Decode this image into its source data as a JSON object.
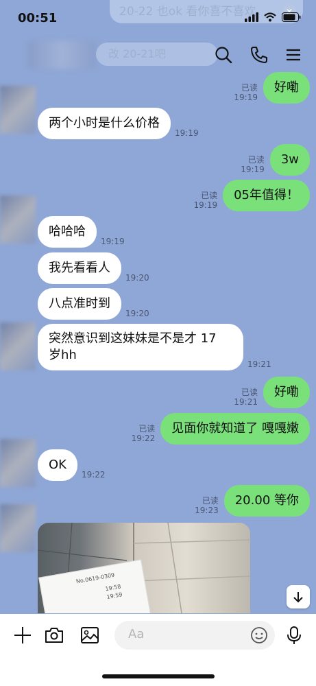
{
  "status": {
    "time": "00:51",
    "notification": "20-22 也ok 看你喜不喜欢"
  },
  "header": {
    "title": "改 20-21吧"
  },
  "messages": [
    {
      "side": "out",
      "text": "好嘞",
      "read": "已读",
      "time": "19:19"
    },
    {
      "side": "in",
      "text": "两个小时是什么价格",
      "time": "19:19"
    },
    {
      "side": "out",
      "text": "3w",
      "read": "已读",
      "time": "19:19"
    },
    {
      "side": "out",
      "text": "05年值得！",
      "read": "已读",
      "time": "19:19"
    },
    {
      "side": "in",
      "text": "哈哈哈",
      "time": "19:19"
    },
    {
      "side": "in",
      "text": "我先看看人",
      "time": "19:20"
    },
    {
      "side": "in",
      "text": "八点准时到",
      "time": "19:20"
    },
    {
      "side": "in",
      "text": "突然意识到这妹妹是不是才 17 岁hh",
      "time": "19:21"
    },
    {
      "side": "out",
      "text": "好嘞",
      "read": "已读",
      "time": "19:21"
    },
    {
      "side": "out",
      "text": "见面你就知道了 嘎嘎嫩",
      "read": "已读",
      "time": "19:22"
    },
    {
      "side": "in",
      "text": "OK",
      "time": "19:22"
    },
    {
      "side": "out",
      "text": "20.00 等你",
      "read": "已读",
      "time": "19:23"
    }
  ],
  "receipt_text": {
    "line1": "No.0619-0309",
    "line2": "19:58",
    "line3": "19:59"
  },
  "input": {
    "placeholder": "Aa"
  },
  "colors": {
    "background": "#8fa7d6",
    "outgoing_bubble": "#7ae07a",
    "incoming_bubble": "#ffffff"
  }
}
